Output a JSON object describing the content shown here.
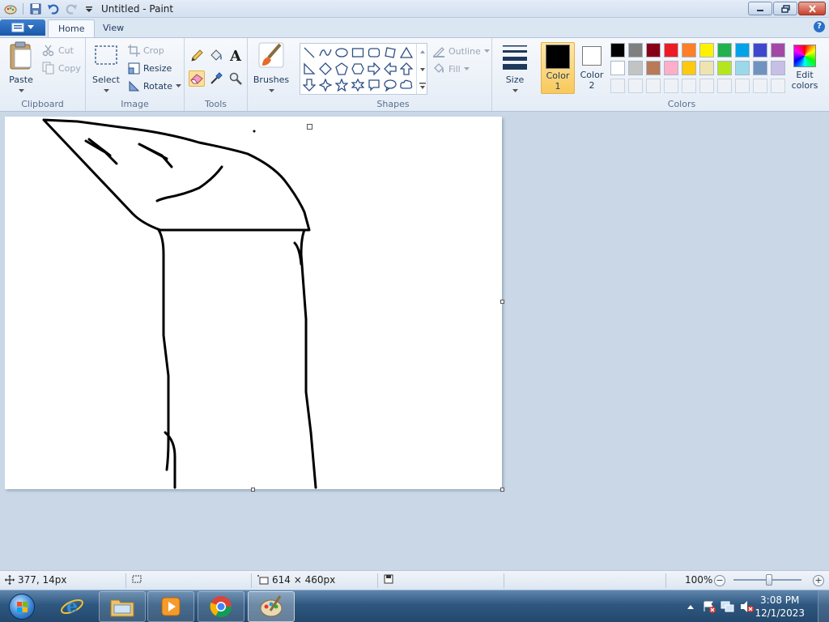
{
  "window": {
    "title": "Untitled - Paint",
    "controls": {
      "minimize": "minimize",
      "restore": "restore",
      "close": "close"
    }
  },
  "tabs": [
    {
      "label": "Home",
      "active": true
    },
    {
      "label": "View",
      "active": false
    }
  ],
  "ribbon": {
    "clipboard": {
      "group_label": "Clipboard",
      "paste": "Paste",
      "cut": "Cut",
      "copy": "Copy"
    },
    "image": {
      "group_label": "Image",
      "select": "Select",
      "crop": "Crop",
      "resize": "Resize",
      "rotate": "Rotate"
    },
    "tools": {
      "group_label": "Tools",
      "items": [
        "pencil-icon",
        "fill-icon",
        "text-icon",
        "eraser-icon",
        "color-picker-icon",
        "magnifier-icon"
      ],
      "active": "eraser-icon"
    },
    "brushes": {
      "label": "Brushes"
    },
    "shapes": {
      "group_label": "Shapes",
      "outline": "Outline",
      "fill": "Fill"
    },
    "size": {
      "label": "Size"
    },
    "colors": {
      "group_label": "Colors",
      "color1_label": "Color 1",
      "color1_line1": "Color",
      "color1_line2": "1",
      "color2_line1": "Color",
      "color2_line2": "2",
      "color1_value": "#000000",
      "color2_value": "#ffffff",
      "edit_line1": "Edit",
      "edit_line2": "colors",
      "palette_row1": [
        "#000000",
        "#7f7f7f",
        "#880015",
        "#ed1c24",
        "#ff7f27",
        "#fff200",
        "#22b14c",
        "#00a2e8",
        "#3f48cc",
        "#a349a4"
      ],
      "palette_row2": [
        "#ffffff",
        "#c3c3c3",
        "#b97a57",
        "#ffaec9",
        "#ffc90e",
        "#efe4b0",
        "#b5e61d",
        "#99d9ea",
        "#7092be",
        "#c8bfe7"
      ]
    }
  },
  "canvas": {
    "background": "#ffffff",
    "stroke_color": "#000000"
  },
  "statusbar": {
    "cursor_pos": "377, 14px",
    "canvas_size": "614 × 460px",
    "zoom": "100%"
  },
  "taskbar": {
    "apps": [
      "internet-explorer-icon",
      "file-explorer-icon",
      "media-player-icon",
      "chrome-icon",
      "paint-icon"
    ],
    "active_app": "paint-icon",
    "time": "3:08 PM",
    "date": "12/1/2023"
  }
}
